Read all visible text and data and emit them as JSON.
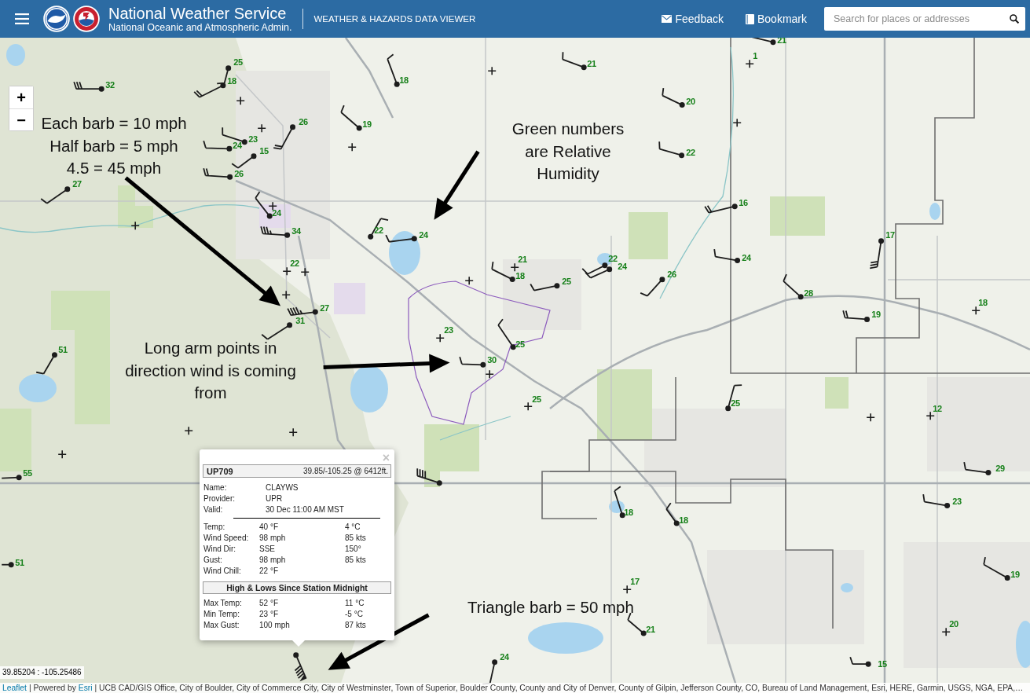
{
  "header": {
    "title": "National Weather Service",
    "subtitle": "National Oceanic and Atmospheric Admin.",
    "app_name": "WEATHER & HAZARDS DATA VIEWER",
    "links": [
      {
        "label": "Feedback"
      },
      {
        "label": "Bookmark"
      }
    ],
    "search": {
      "placeholder": "Search for places or addresses"
    }
  },
  "map": {
    "zoom_controls": [
      "+",
      "−"
    ],
    "stations": [
      {
        "kind": "barb",
        "rh": "25"
      },
      {
        "kind": "barb",
        "rh": "18"
      },
      {
        "kind": "barb",
        "rh": "32"
      },
      {
        "kind": "barb",
        "rh": "18"
      },
      {
        "kind": "barb",
        "rh": "21"
      },
      {
        "kind": "barb",
        "rh": "21"
      },
      {
        "kind": "calm",
        "rh": "1"
      },
      {
        "kind": "barb",
        "rh": "26"
      },
      {
        "kind": "barb",
        "rh": "19"
      },
      {
        "kind": "barb",
        "rh": "20"
      },
      {
        "kind": "barb",
        "rh": "23"
      },
      {
        "kind": "barb",
        "rh": "24"
      },
      {
        "kind": "barb",
        "rh": "15"
      },
      {
        "kind": "barb",
        "rh": "22"
      },
      {
        "kind": "barb",
        "rh": "26"
      },
      {
        "kind": "barb",
        "rh": "27"
      },
      {
        "kind": "barb",
        "rh": "16"
      },
      {
        "kind": "barb",
        "rh": "24"
      },
      {
        "kind": "barb",
        "rh": "34"
      },
      {
        "kind": "barb",
        "rh": "22"
      },
      {
        "kind": "barb",
        "rh": "24"
      },
      {
        "kind": "barb",
        "rh": "17"
      },
      {
        "kind": "calm",
        "rh": "21"
      },
      {
        "kind": "barb",
        "rh": "22"
      },
      {
        "kind": "barb",
        "rh": "24"
      },
      {
        "kind": "barb",
        "rh": "24"
      },
      {
        "kind": "calm",
        "rh": "22"
      },
      {
        "kind": "barb",
        "rh": "18"
      },
      {
        "kind": "barb",
        "rh": "26"
      },
      {
        "kind": "barb",
        "rh": "25"
      },
      {
        "kind": "barb",
        "rh": "28"
      },
      {
        "kind": "calm",
        "rh": "18"
      },
      {
        "kind": "barb",
        "rh": "27"
      },
      {
        "kind": "barb",
        "rh": "19"
      },
      {
        "kind": "barb",
        "rh": "31"
      },
      {
        "kind": "calm",
        "rh": "23"
      },
      {
        "kind": "barb",
        "rh": "25"
      },
      {
        "kind": "barb",
        "rh": "51"
      },
      {
        "kind": "barb",
        "rh": "30"
      },
      {
        "kind": "calm",
        "rh": "25"
      },
      {
        "kind": "barb",
        "rh": "25"
      },
      {
        "kind": "calm",
        "rh": "12"
      },
      {
        "kind": "barb",
        "rh": "29"
      },
      {
        "kind": "barb",
        "rh": "55"
      },
      {
        "kind": "barb",
        "rh": "23"
      },
      {
        "kind": "barb",
        "rh": "18"
      },
      {
        "kind": "barb",
        "rh": "18"
      },
      {
        "kind": "barb",
        "rh": "51"
      },
      {
        "kind": "barb",
        "rh": "19"
      },
      {
        "kind": "calm",
        "rh": "17"
      },
      {
        "kind": "calm",
        "rh": "20"
      },
      {
        "kind": "barb",
        "rh": "21"
      },
      {
        "kind": "barb",
        "rh": "24"
      },
      {
        "kind": "barb",
        "rh": "15"
      }
    ],
    "popup": {
      "close": "×",
      "station_id": "UP709",
      "location": "39.85/-105.25 @ 6412ft.",
      "info": [
        {
          "label": "Name:",
          "value": "CLAYWS"
        },
        {
          "label": "Provider:",
          "value": "UPR"
        },
        {
          "label": "Valid:",
          "value": "30 Dec 11:00 AM MST"
        }
      ],
      "observations": [
        {
          "label": "Temp:",
          "value": "40 °F",
          "value_2": "4 °C"
        },
        {
          "label": "Wind Speed:",
          "value": "98 mph",
          "value_2": "85 kts"
        },
        {
          "label": "Wind Dir:",
          "value": "SSE",
          "value_2": "150°"
        },
        {
          "label": "Gust:",
          "value": "98 mph",
          "value_2": "85 kts"
        },
        {
          "label": "Wind Chill:",
          "value": "22 °F"
        }
      ],
      "section_title": "High & Lows Since Station Midnight",
      "extremes": [
        {
          "label": "Max Temp:",
          "value": "52 °F",
          "value_2": "11 °C"
        },
        {
          "label": "Min Temp:",
          "value": "23 °F",
          "value_2": "-5 °C"
        },
        {
          "label": "Max Gust:",
          "value": "100 mph",
          "value_2": "87 kts"
        }
      ]
    },
    "coordinates": "39.85204 : -105.25486",
    "attribution": [
      {
        "kind": "link",
        "text": "Leaflet"
      },
      {
        "kind": "text",
        "text": "| Powered by"
      },
      {
        "kind": "link",
        "text": "Esri"
      },
      {
        "kind": "text",
        "text": "| UCB CAD/GIS Office, City of Boulder, City of Commerce City, City of Westminster, Town of Superior, Boulder County, County and City of Denver, County of Gilpin, Jefferson County, CO, Bureau of Land Management, Esri, HERE, Garmin, USGS, NGA, EPA,…"
      }
    ]
  },
  "annotations": [
    {
      "lines": [
        "Each barb = 10 mph",
        "Half barb = 5 mph",
        "4.5 = 45 mph"
      ]
    },
    {
      "lines": [
        "Green numbers",
        "are Relative",
        "Humidity"
      ]
    },
    {
      "lines": [
        "Long arm points in",
        "direction wind is coming",
        "from"
      ]
    },
    {
      "lines": [
        "Triangle barb = 50 mph"
      ]
    }
  ]
}
